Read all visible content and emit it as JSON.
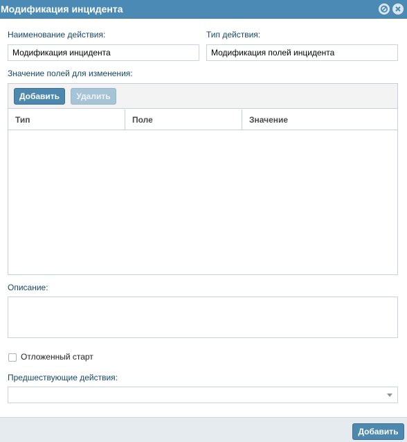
{
  "window": {
    "title": "Модификация инцидента"
  },
  "form": {
    "action_name_label": "Наименование действия:",
    "action_name_value": "Модификация инцидента",
    "action_type_label": "Тип действия:",
    "action_type_value": "Модификация полей инцидента",
    "fields_label": "Значение полей для изменения:",
    "description_label": "Описание:",
    "description_value": "",
    "delayed_start_label": "Отложенный старт",
    "delayed_start_checked": false,
    "previous_actions_label": "Предшествующие действия:",
    "previous_actions_value": ""
  },
  "grid": {
    "add_button": "Добавить",
    "delete_button": "Удалить",
    "columns": [
      "Тип",
      "Поле",
      "Значение"
    ],
    "rows": []
  },
  "footer": {
    "submit_button": "Добавить"
  },
  "colors": {
    "titlebar": "#4a8ab5",
    "primary_button": "#4d88af",
    "disabled_button": "#a7c3d6",
    "label": "#15466a"
  }
}
